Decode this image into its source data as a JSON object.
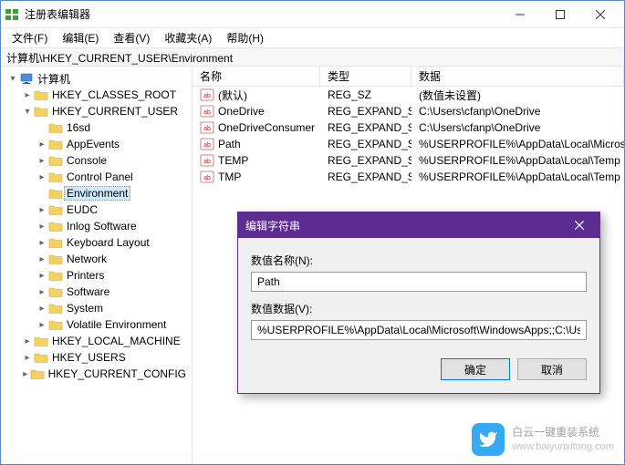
{
  "window": {
    "title": "注册表编辑器"
  },
  "menu": {
    "file": "文件(F)",
    "edit": "编辑(E)",
    "view": "查看(V)",
    "fav": "收藏夹(A)",
    "help": "帮助(H)"
  },
  "address": "计算机\\HKEY_CURRENT_USER\\Environment",
  "tree": {
    "root": "计算机",
    "nodes": [
      {
        "label": "HKEY_CLASSES_ROOT",
        "depth": 1,
        "chev": "collapsed"
      },
      {
        "label": "HKEY_CURRENT_USER",
        "depth": 1,
        "chev": "expanded"
      },
      {
        "label": "16sd",
        "depth": 2,
        "chev": "empty"
      },
      {
        "label": "AppEvents",
        "depth": 2,
        "chev": "collapsed"
      },
      {
        "label": "Console",
        "depth": 2,
        "chev": "collapsed"
      },
      {
        "label": "Control Panel",
        "depth": 2,
        "chev": "collapsed"
      },
      {
        "label": "Environment",
        "depth": 2,
        "chev": "empty",
        "selected": true
      },
      {
        "label": "EUDC",
        "depth": 2,
        "chev": "collapsed"
      },
      {
        "label": "Inlog Software",
        "depth": 2,
        "chev": "collapsed"
      },
      {
        "label": "Keyboard Layout",
        "depth": 2,
        "chev": "collapsed"
      },
      {
        "label": "Network",
        "depth": 2,
        "chev": "collapsed"
      },
      {
        "label": "Printers",
        "depth": 2,
        "chev": "collapsed"
      },
      {
        "label": "Software",
        "depth": 2,
        "chev": "collapsed"
      },
      {
        "label": "System",
        "depth": 2,
        "chev": "collapsed"
      },
      {
        "label": "Volatile Environment",
        "depth": 2,
        "chev": "collapsed"
      },
      {
        "label": "HKEY_LOCAL_MACHINE",
        "depth": 1,
        "chev": "collapsed"
      },
      {
        "label": "HKEY_USERS",
        "depth": 1,
        "chev": "collapsed"
      },
      {
        "label": "HKEY_CURRENT_CONFIG",
        "depth": 1,
        "chev": "collapsed"
      }
    ]
  },
  "list": {
    "headers": {
      "name": "名称",
      "type": "类型",
      "data": "数据"
    },
    "rows": [
      {
        "name": "(默认)",
        "type": "REG_SZ",
        "data": "(数值未设置)"
      },
      {
        "name": "OneDrive",
        "type": "REG_EXPAND_SZ",
        "data": "C:\\Users\\cfanp\\OneDrive"
      },
      {
        "name": "OneDriveConsumer",
        "type": "REG_EXPAND_SZ",
        "data": "C:\\Users\\cfanp\\OneDrive"
      },
      {
        "name": "Path",
        "type": "REG_EXPAND_SZ",
        "data": "%USERPROFILE%\\AppData\\Local\\Microsoft\\..."
      },
      {
        "name": "TEMP",
        "type": "REG_EXPAND_SZ",
        "data": "%USERPROFILE%\\AppData\\Local\\Temp"
      },
      {
        "name": "TMP",
        "type": "REG_EXPAND_SZ",
        "data": "%USERPROFILE%\\AppData\\Local\\Temp"
      }
    ]
  },
  "dialog": {
    "title": "编辑字符串",
    "name_label": "数值名称(N):",
    "name_value": "Path",
    "data_label": "数值数据(V):",
    "data_value": "%USERPROFILE%\\AppData\\Local\\Microsoft\\WindowsApps;;C:\\Users\\cf...",
    "ok": "确定",
    "cancel": "取消"
  },
  "watermark": {
    "text": "白云一键重装系统",
    "sub": "www.baiyunxitong.com"
  }
}
